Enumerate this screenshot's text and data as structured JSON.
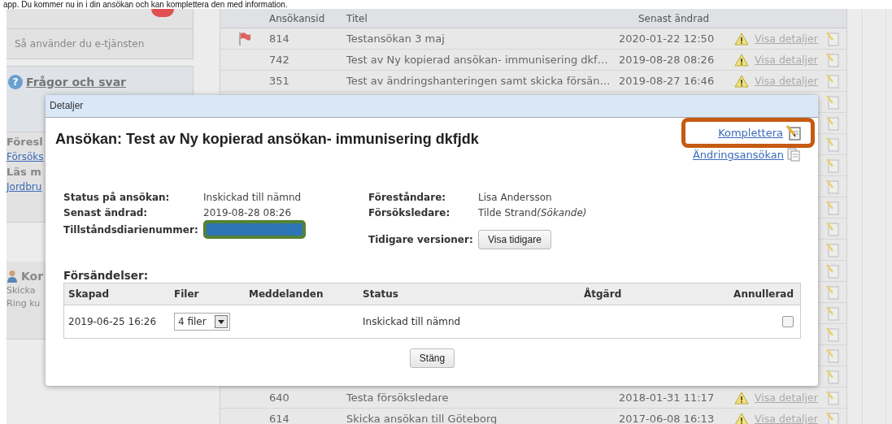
{
  "intro_text": "app. Du kommer nu in i din ansökan och kan komplettera den med information.",
  "sidebar": {
    "menu_items": [
      {
        "label": "Så använder du e-tjänsten"
      }
    ],
    "faq_icon": "?",
    "faq_link": "Frågor och svar",
    "fragments": [
      {
        "kind": "heading",
        "text": "Föresl"
      },
      {
        "kind": "link",
        "text": "Försöks"
      },
      {
        "kind": "heading",
        "text": "Läs m"
      },
      {
        "kind": "link",
        "text": "Jordbru"
      }
    ],
    "contact": {
      "heading": "Kor",
      "lines": [
        "Skicka",
        "Ring ku"
      ]
    }
  },
  "table": {
    "columns": [
      "Ansökansid",
      "Titel",
      "Senast ändrad"
    ],
    "rows": [
      {
        "covered": false,
        "flagged": true,
        "id": "814",
        "title": "Testansökan 3 maj",
        "date": "2020-01-22 12:50",
        "link": "Visa detaljer"
      },
      {
        "covered": false,
        "flagged": false,
        "id": "742",
        "title": "Test av Ny kopierad ansökan- immunisering dkf…",
        "date": "2019-08-28 08:26",
        "link": "Visa detaljer"
      },
      {
        "covered": false,
        "flagged": false,
        "id": "351",
        "title": "Test av ändringshanteringen samt skicka försän…",
        "date": "2019-08-27 16:46",
        "link": "Visa detaljer"
      },
      {
        "covered": true
      },
      {
        "covered": true
      },
      {
        "covered": true
      },
      {
        "covered": true
      },
      {
        "covered": true
      },
      {
        "covered": true
      },
      {
        "covered": true
      },
      {
        "covered": true
      },
      {
        "covered": true
      },
      {
        "covered": true
      },
      {
        "covered": true
      },
      {
        "covered": true
      },
      {
        "covered": true
      },
      {
        "covered": true
      },
      {
        "covered": false,
        "flagged": false,
        "id": "640",
        "title": "Testa försöksledare",
        "date": "2018-01-31 11:17",
        "link": "Visa detaljer"
      },
      {
        "covered": false,
        "flagged": false,
        "id": "614",
        "title": "Skicka ansökan till Göteborg",
        "date": "2017-06-08 16:13",
        "link": "Visa detaljer"
      }
    ]
  },
  "dialog": {
    "title": "Detaljer",
    "heading": "Ansökan: Test av Ny kopierad ansökan- immunisering dkfjdk",
    "actions": [
      {
        "kind": "edit",
        "label": "Komplettera",
        "highlighted": true
      },
      {
        "kind": "document",
        "label": "Ändringsansökan",
        "highlighted": false
      }
    ],
    "info_left": [
      {
        "label": "Status på ansökan:",
        "value": "Inskickad till nämnd",
        "redacted": false
      },
      {
        "label": "Senast ändrad:",
        "value": "2019-08-28 08:26",
        "redacted": false
      },
      {
        "label": "Tillståndsdiarienummer:",
        "redacted": true
      }
    ],
    "info_right": [
      {
        "label": "Föreståndare:",
        "value": "Lisa Andersson"
      },
      {
        "label": "Försöksledare:",
        "value": "Tilde Strand",
        "note": "(Sökande)"
      }
    ],
    "versions": {
      "label": "Tidigare versioner:",
      "button": "Visa tidigare"
    },
    "shipments": {
      "title": "Försändelser:",
      "columns": [
        "Skapad",
        "Filer",
        "Meddelanden",
        "Status",
        "Åtgärd",
        "Annullerad"
      ],
      "rows": [
        {
          "created": "2019-06-25 16:26",
          "files": "4 filer",
          "status": "Inskickad till nämnd",
          "cancelled": false
        }
      ]
    },
    "close_button": "Stäng"
  }
}
